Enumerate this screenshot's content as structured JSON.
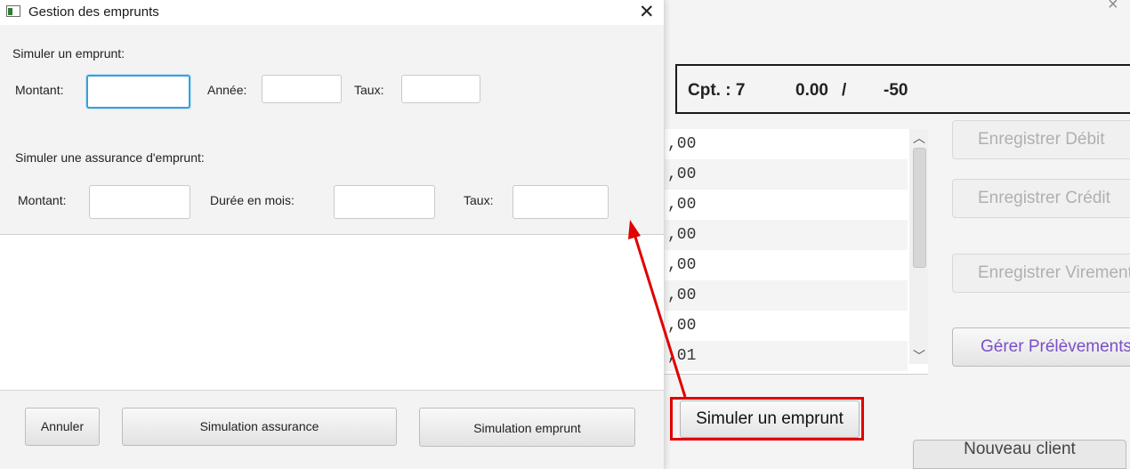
{
  "background_window": {
    "status": {
      "account": "Cpt. : 7",
      "balance": "0.00",
      "separator": "/",
      "overdraft": "-50"
    },
    "operations": [
      ",00",
      ",00",
      ",00",
      ",00",
      ",00",
      ",00",
      ",00",
      ",01"
    ],
    "buttons": {
      "debit": "Enregistrer Débit",
      "credit": "Enregistrer Crédit",
      "transfer": "Enregistrer Virement",
      "direct_debits": "Gérer Prélèvements",
      "simulate": "Simuler un emprunt",
      "new_client": "Nouveau client"
    },
    "highlight_color": "#e10000"
  },
  "dialog": {
    "title": "Gestion des emprunts",
    "close_icon": "close-icon",
    "loan": {
      "heading": "Simuler un emprunt:",
      "amount_label": "Montant:",
      "year_label": "Année:",
      "rate_label": "Taux:",
      "amount_value": "",
      "year_value": "",
      "rate_value": ""
    },
    "insurance": {
      "heading": "Simuler une assurance d'emprunt:",
      "amount_label": "Montant:",
      "duration_label": "Durée en mois:",
      "rate_label": "Taux:",
      "amount_value": "",
      "duration_value": "",
      "rate_value": ""
    },
    "footer": {
      "cancel": "Annuler",
      "insurance_sim": "Simulation assurance",
      "loan_sim": "Simulation emprunt"
    }
  }
}
